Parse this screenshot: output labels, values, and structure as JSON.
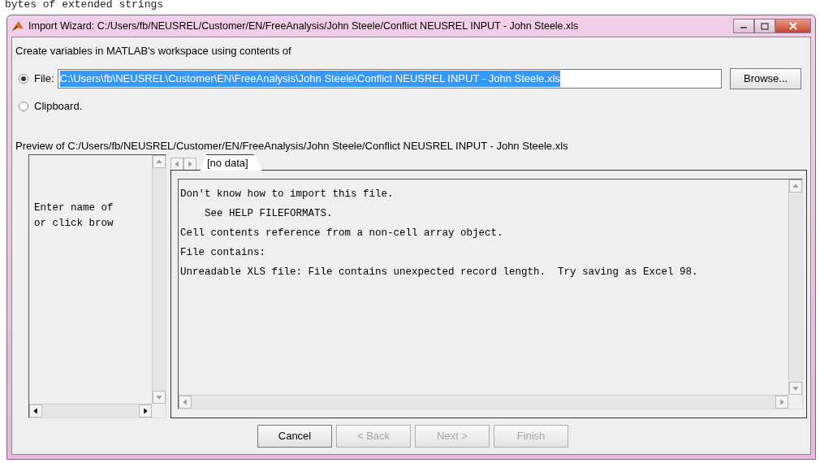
{
  "background": {
    "console_text": "bytes of extended strings"
  },
  "window": {
    "title": "Import Wizard: C:/Users/fb/NEUSREL/Customer/EN/FreeAnalysis/John Steele/Conflict NEUSREL INPUT - John Steele.xls"
  },
  "intro": "Create variables in MATLAB's workspace using contents of",
  "sources": [
    {
      "label": "File:",
      "selected": true,
      "kind": "file",
      "value": "C:\\Users\\fb\\NEUSREL\\Customer\\EN\\FreeAnalysis\\John Steele\\Conflict NEUSREL INPUT - John Steele.xls",
      "button": "Browse..."
    },
    {
      "label": "Clipboard.",
      "selected": false,
      "kind": "plain"
    }
  ],
  "preview_label": "Preview of C:/Users/fb/NEUSREL/Customer/EN/FreeAnalysis/John Steele/Conflict NEUSREL INPUT - John Steele.xls",
  "left_pane": {
    "lines": [
      "Enter name of",
      "or click brow"
    ]
  },
  "tabs": [
    {
      "label": "[no data]",
      "selected": true
    }
  ],
  "message": {
    "lines": [
      "Don't know how to import this file.",
      "    See HELP FILEFORMATS.",
      "Cell contents reference from a non-cell array object.",
      "File contains:",
      "Unreadable XLS file: File contains unexpected record length.  Try saving as Excel 98."
    ]
  },
  "buttons": [
    {
      "label": "Cancel",
      "disabled": false
    },
    {
      "label": "< Back",
      "disabled": true
    },
    {
      "label": "Next >",
      "disabled": true
    },
    {
      "label": "Finish",
      "disabled": true
    }
  ]
}
